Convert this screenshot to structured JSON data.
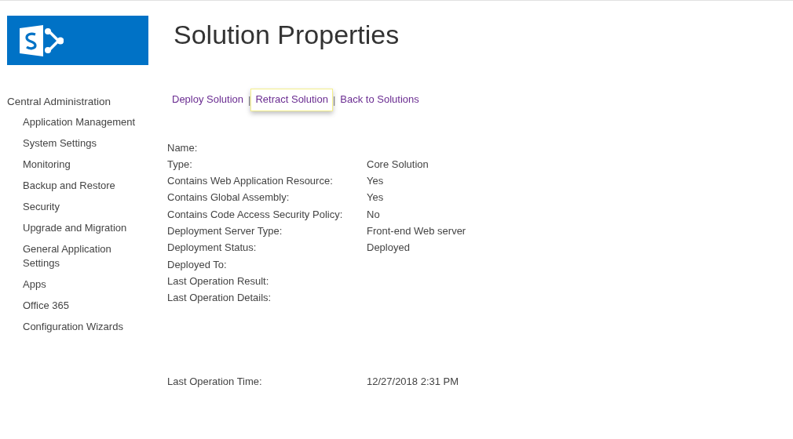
{
  "page": {
    "title": "Solution Properties"
  },
  "sidebar": {
    "heading": "Central Administration",
    "items": [
      {
        "label": "Application Management"
      },
      {
        "label": "System Settings"
      },
      {
        "label": "Monitoring"
      },
      {
        "label": "Backup and Restore"
      },
      {
        "label": "Security"
      },
      {
        "label": "Upgrade and Migration"
      },
      {
        "label": "General Application Settings"
      },
      {
        "label": "Apps"
      },
      {
        "label": "Office 365"
      },
      {
        "label": "Configuration Wizards"
      }
    ]
  },
  "actions": [
    {
      "label": "Deploy Solution",
      "highlighted": false
    },
    {
      "label": "Retract Solution",
      "highlighted": true
    },
    {
      "label": "Back to Solutions",
      "highlighted": false
    }
  ],
  "separator": "|",
  "properties": [
    {
      "label": "Name:"
    },
    {
      "label": "Type:",
      "value": "Core Solution"
    },
    {
      "label": "Contains Web Application Resource:",
      "value": "Yes"
    },
    {
      "label": "Contains Global Assembly:",
      "value": "Yes"
    },
    {
      "label": "Contains Code Access Security Policy:",
      "value": "No"
    },
    {
      "label": "Deployment Server Type:",
      "value": "Front-end Web server"
    },
    {
      "label": "Deployment Status:",
      "value": "Deployed"
    },
    {
      "label": "Deployed To:"
    },
    {
      "label": "Last Operation Result:"
    },
    {
      "label": "Last Operation Details:"
    },
    {
      "label": "Last Operation Time:",
      "value": "12/27/2018 2:31 PM"
    }
  ]
}
